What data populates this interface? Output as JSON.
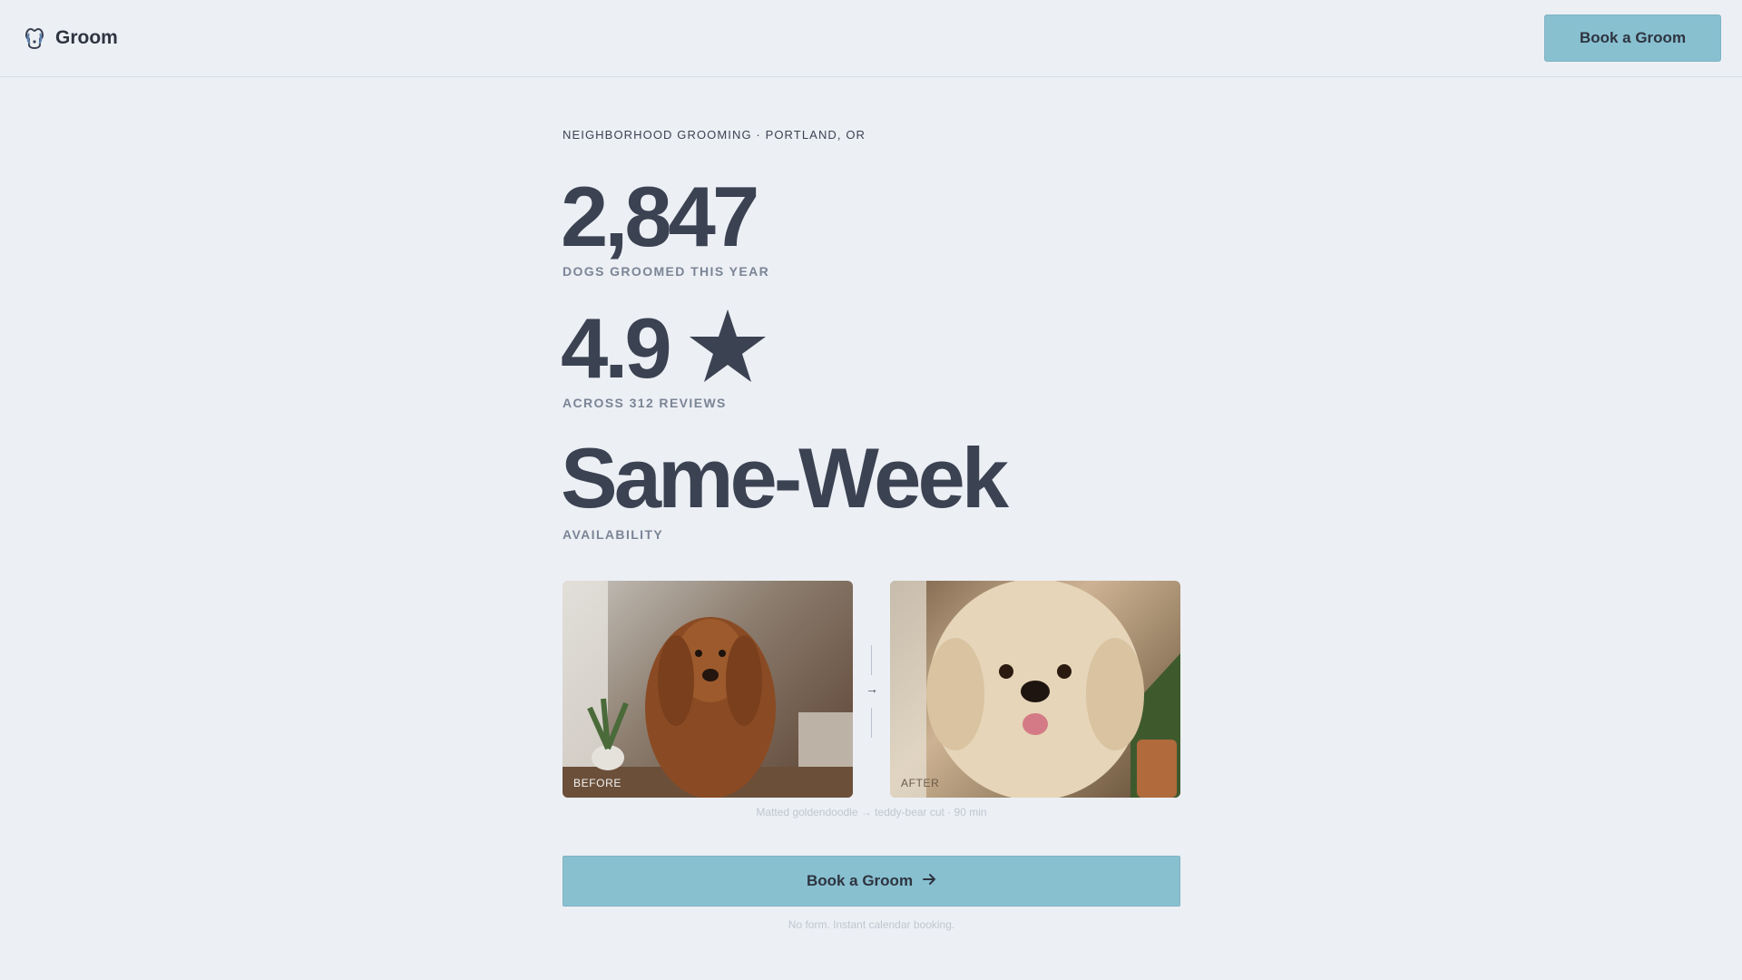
{
  "header": {
    "brand": "Groom",
    "brand_icon": "dog-icon",
    "book_label": "Book a Groom"
  },
  "hero": {
    "eyebrow": "NEIGHBORHOOD GROOMING · PORTLAND, OR",
    "stats": [
      {
        "value": "2,847",
        "label": "DOGS GROOMED THIS YEAR"
      },
      {
        "value": "4.9",
        "icon": "star-icon",
        "label": "ACROSS 312 REVIEWS"
      },
      {
        "value": "Same-Week",
        "label": "AVAILABILITY"
      }
    ]
  },
  "gallery": {
    "before_label": "BEFORE",
    "after_label": "AFTER",
    "arrow": "→",
    "caption": "Matted goldendoodle → teddy-bear cut · 90 min"
  },
  "cta": {
    "label": "Book a Groom",
    "icon": "arrow-right-icon",
    "note": "No form. Instant calendar booking."
  },
  "colors": {
    "background": "#ECEFF4",
    "accent": "#88C0D0",
    "text": "#3B4252",
    "muted": "#7B8596"
  }
}
